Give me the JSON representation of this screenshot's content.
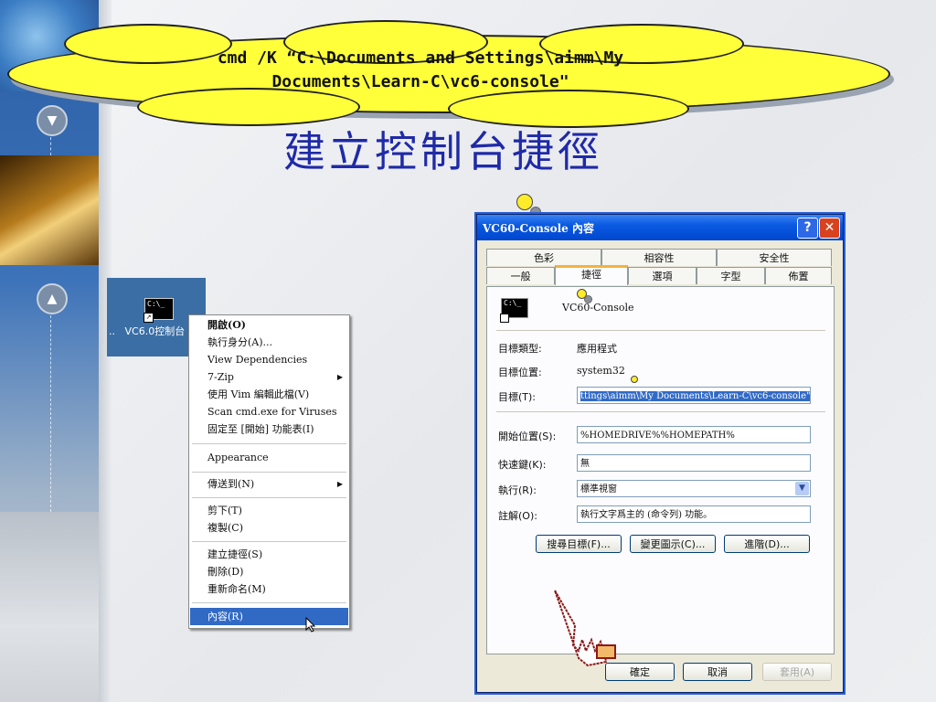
{
  "callout": {
    "line1": "cmd /K “C:\\Documents and Settings\\aimm\\My",
    "line2": "Documents\\Learn-C\\vc6-console\""
  },
  "title": "建立控制台捷徑",
  "desktop_icon": {
    "ellipsis": "..",
    "label": "VC6.0控制台",
    "icon_text": "C:\\_",
    "shortcut_arrow": "↗"
  },
  "context_menu": {
    "items": [
      {
        "label": "開啟(O)",
        "bold": true
      },
      {
        "label": "執行身分(A)..."
      },
      {
        "label": "View Dependencies"
      },
      {
        "label": "7-Zip",
        "submenu": "▶"
      },
      {
        "label": "使用 Vim 編輯此檔(V)"
      },
      {
        "label": "Scan cmd.exe for Viruses"
      },
      {
        "label": "固定至 [開始] 功能表(I)"
      },
      {
        "label": "Appearance"
      },
      {
        "label": "傳送到(N)",
        "submenu": "▶"
      },
      {
        "label": "剪下(T)"
      },
      {
        "label": "複製(C)"
      },
      {
        "label": "建立捷徑(S)"
      },
      {
        "label": "刪除(D)"
      },
      {
        "label": "重新命名(M)"
      },
      {
        "label": "內容(R)",
        "selected": true
      }
    ]
  },
  "dialog": {
    "title": "VC60-Console 內容",
    "help": "?",
    "close": "✕",
    "tabs_row1": [
      "色彩",
      "相容性",
      "安全性"
    ],
    "tabs_row2": [
      "一般",
      "捷徑",
      "選項",
      "字型",
      "佈置"
    ],
    "active_tab": "捷徑",
    "shortcut_name": "VC60-Console",
    "icon_text": "C:\\_",
    "fields": {
      "target_type_label": "目標類型:",
      "target_type_value": "應用程式",
      "target_location_label": "目標位置:",
      "target_location_value": "system32",
      "target_label": "目標(T):",
      "target_value": "ttings\\aimm\\My Documents\\Learn-C\\vc6-console\"",
      "start_in_label": "開始位置(S):",
      "start_in_value": "%HOMEDRIVE%%HOMEPATH%",
      "shortcut_key_label": "快速鍵(K):",
      "shortcut_key_value": "無",
      "run_label": "執行(R):",
      "run_value": "標準視窗",
      "comment_label": "註解(O):",
      "comment_value": "執行文字爲主的 (命令列) 功能。"
    },
    "buttons": {
      "find_target": "搜尋目標(F)...",
      "change_icon": "變更圖示(C)...",
      "advanced": "進階(D)...",
      "ok": "確定",
      "cancel": "取消",
      "apply": "套用(A)"
    }
  },
  "nav": {
    "down_icon": "▼",
    "up_icon": "▲"
  }
}
